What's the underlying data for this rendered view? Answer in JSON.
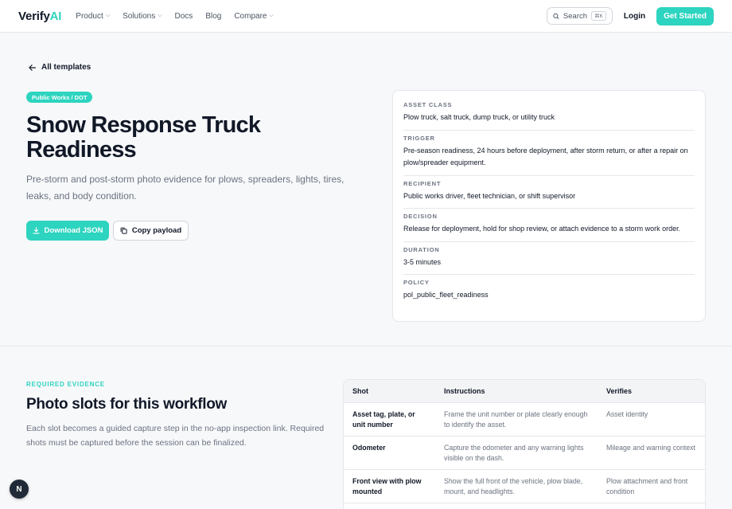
{
  "nav": {
    "logo_main": "Verify",
    "logo_accent": "AI",
    "links": [
      {
        "label": "Product",
        "has_dropdown": true
      },
      {
        "label": "Solutions",
        "has_dropdown": true
      },
      {
        "label": "Docs",
        "has_dropdown": false
      },
      {
        "label": "Blog",
        "has_dropdown": false
      },
      {
        "label": "Compare",
        "has_dropdown": true
      }
    ],
    "search_label": "Search",
    "search_shortcut": "⌘K",
    "login_label": "Login",
    "cta_label": "Get Started"
  },
  "hero": {
    "back_label": "All templates",
    "badge": "Public Works / DOT",
    "title": "Snow Response Truck Readiness",
    "subtitle": "Pre-storm and post-storm photo evidence for plows, spreaders, lights, tires, leaks, and body condition.",
    "download_label": "Download JSON",
    "copy_label": "Copy payload"
  },
  "meta": [
    {
      "label": "ASSET CLASS",
      "value": "Plow truck, salt truck, dump truck, or utility truck"
    },
    {
      "label": "TRIGGER",
      "value": "Pre-season readiness, 24 hours before deployment, after storm return, or after a repair on plow/spreader equipment."
    },
    {
      "label": "RECIPIENT",
      "value": "Public works driver, fleet technician, or shift supervisor"
    },
    {
      "label": "DECISION",
      "value": "Release for deployment, hold for shop review, or attach evidence to a storm work order."
    },
    {
      "label": "DURATION",
      "value": "3-5 minutes"
    },
    {
      "label": "POLICY",
      "value": "pol_public_fleet_readiness"
    }
  ],
  "evidence": {
    "kicker": "REQUIRED EVIDENCE",
    "title": "Photo slots for this workflow",
    "subtitle": "Each slot becomes a guided capture step in the no-app inspection link. Required shots must be captured before the session can be finalized.",
    "columns": [
      "Shot",
      "Instructions",
      "Verifies"
    ],
    "rows": [
      {
        "shot": "Asset tag, plate, or unit number",
        "instructions": "Frame the unit number or plate clearly enough to identify the asset.",
        "verifies": "Asset identity"
      },
      {
        "shot": "Odometer",
        "instructions": "Capture the odometer and any warning lights visible on the dash.",
        "verifies": "Mileage and warning context"
      },
      {
        "shot": "Front view with plow mounted",
        "instructions": "Show the full front of the vehicle, plow blade, mount, and headlights.",
        "verifies": "Plow attachment and front condition"
      }
    ]
  },
  "fab_label": "N"
}
